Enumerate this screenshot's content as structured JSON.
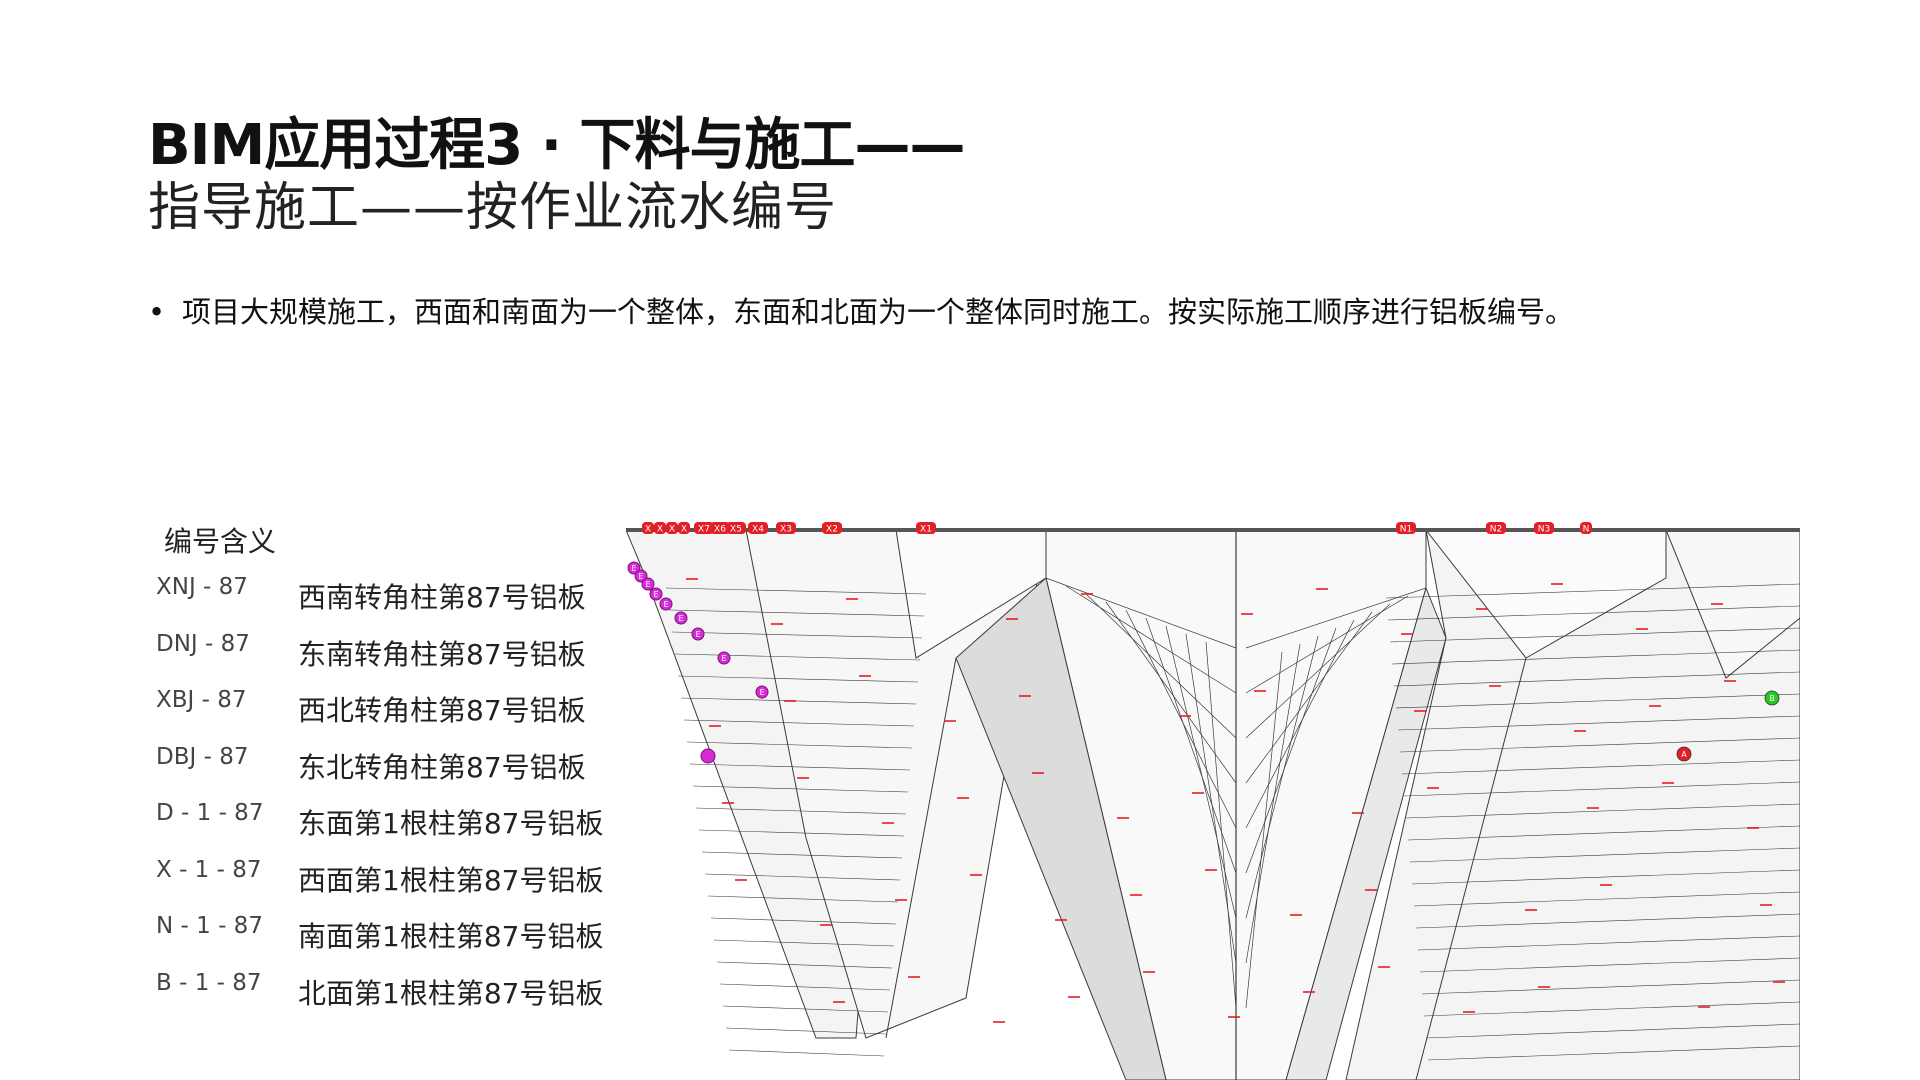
{
  "title": {
    "line1": "BIM应用过程3 · 下料与施工——",
    "line2": "指导施工——按作业流水编号"
  },
  "bullet": {
    "dot": "•",
    "text": "项目大规模施工，西面和南面为一个整体，东面和北面为一个整体同时施工。按实际施工顺序进行铝板编号。"
  },
  "legend": {
    "title": "编号含义",
    "rows": [
      {
        "code": "XNJ - 87",
        "desc": "西南转角柱第87号铝板"
      },
      {
        "code": "DNJ - 87",
        "desc": "东南转角柱第87号铝板"
      },
      {
        "code": "XBJ - 87",
        "desc": "西北转角柱第87号铝板"
      },
      {
        "code": "DBJ - 87",
        "desc": "东北转角柱第87号铝板"
      },
      {
        "code": "D - 1 - 87",
        "desc": "东面第1根柱第87号铝板"
      },
      {
        "code": "X - 1 - 87",
        "desc": "西面第1根柱第87号铝板"
      },
      {
        "code": "N - 1 - 87",
        "desc": "南面第1根柱第87号铝板"
      },
      {
        "code": "B - 1 - 87",
        "desc": "北面第1根柱第87号铝板"
      }
    ]
  },
  "model": {
    "top_tags": [
      "X",
      "X",
      "X",
      "X",
      "X7",
      "X6",
      "X5",
      "X4",
      "X3",
      "X2",
      "X1",
      "N1",
      "N2",
      "N3",
      "N"
    ],
    "side_markers": [
      "E",
      "E",
      "E",
      "E",
      "E",
      "E",
      "E",
      "E",
      "E"
    ],
    "right_markers": [
      "A",
      "B"
    ],
    "colors": {
      "tag_red": "#e31e24",
      "marker_magenta": "#d62bd6",
      "marker_green": "#26c926",
      "panel_face": "#f4f4f4",
      "panel_shadow": "#dcdcdc",
      "panel_line": "#3a3a3a"
    }
  }
}
